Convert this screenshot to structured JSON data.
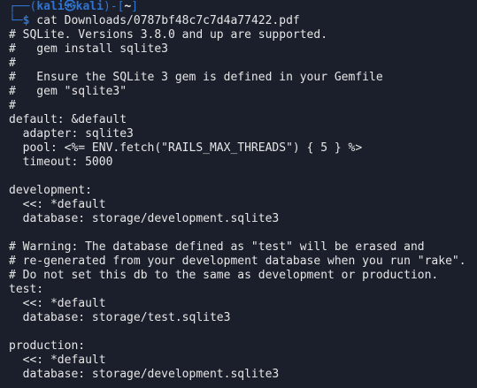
{
  "prompt": {
    "corner_top": "┌──(",
    "user": "kali㉿kali",
    "mid": ")-[",
    "cwd": "~",
    "end": "]",
    "corner_bottom": "└─",
    "dollar": "$",
    "command": " cat Downloads/0787bf48c7c7d4a77422.pdf"
  },
  "output_lines": [
    "# SQLite. Versions 3.8.0 and up are supported.",
    "#   gem install sqlite3",
    "#",
    "#   Ensure the SQLite 3 gem is defined in your Gemfile",
    "#   gem \"sqlite3\"",
    "#",
    "default: &default",
    "  adapter: sqlite3",
    "  pool: <%= ENV.fetch(\"RAILS_MAX_THREADS\") { 5 } %>",
    "  timeout: 5000",
    "",
    "development:",
    "  <<: *default",
    "  database: storage/development.sqlite3",
    "",
    "# Warning: The database defined as \"test\" will be erased and",
    "# re-generated from your development database when you run \"rake\".",
    "# Do not set this db to the same as development or production.",
    "test:",
    "  <<: *default",
    "  database: storage/test.sqlite3",
    "",
    "production:",
    "  <<: *default",
    "  database: storage/development.sqlite3"
  ]
}
